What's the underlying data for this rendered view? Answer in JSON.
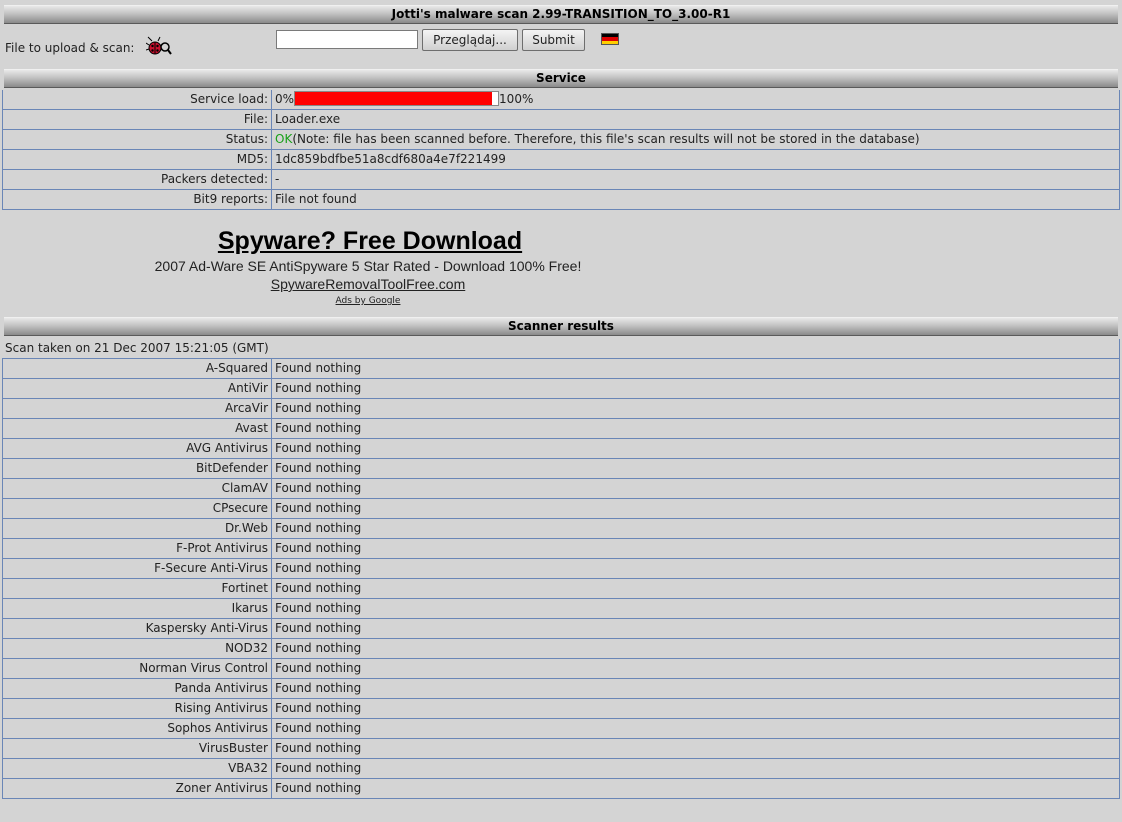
{
  "title": "Jotti's malware scan 2.99-TRANSITION_TO_3.00-R1",
  "upload": {
    "label": "File to upload & scan:",
    "file_value": "",
    "browse_label": "Przeglądaj...",
    "submit_label": "Submit",
    "language_flag": "german-flag-icon"
  },
  "service": {
    "header": "Service",
    "rows": [
      {
        "key": "Service load:",
        "type": "load",
        "min_label": "0%",
        "max_label": "100%",
        "load_fraction": 0.97
      },
      {
        "key": "File:",
        "value": "Loader.exe"
      },
      {
        "key": "Status:",
        "status_ok": "OK",
        "value": "(Note: file has been scanned before. Therefore, this file's scan results will not be stored in the database)"
      },
      {
        "key": "MD5:",
        "value": "1dc859bdfbe51a8cdf680a4e7f221499"
      },
      {
        "key": "Packers detected:",
        "value": "-"
      },
      {
        "key": "Bit9 reports:",
        "value": "File not found"
      }
    ]
  },
  "ad": {
    "title": "Spyware? Free Download",
    "description": "2007 Ad-Ware SE AntiSpyware 5 Star Rated - Download 100% Free!",
    "url": "SpywareRemovalToolFree.com",
    "ads_by": "Ads by Google"
  },
  "scanner": {
    "header": "Scanner results",
    "scan_taken": "Scan taken on 21 Dec 2007 15:21:05 (GMT)",
    "results": [
      {
        "name": "A-Squared",
        "result": "Found nothing"
      },
      {
        "name": "AntiVir",
        "result": "Found nothing"
      },
      {
        "name": "ArcaVir",
        "result": "Found nothing"
      },
      {
        "name": "Avast",
        "result": "Found nothing"
      },
      {
        "name": "AVG Antivirus",
        "result": "Found nothing"
      },
      {
        "name": "BitDefender",
        "result": "Found nothing"
      },
      {
        "name": "ClamAV",
        "result": "Found nothing"
      },
      {
        "name": "CPsecure",
        "result": "Found nothing"
      },
      {
        "name": "Dr.Web",
        "result": "Found nothing"
      },
      {
        "name": "F-Prot Antivirus",
        "result": "Found nothing"
      },
      {
        "name": "F-Secure Anti-Virus",
        "result": "Found nothing"
      },
      {
        "name": "Fortinet",
        "result": "Found nothing"
      },
      {
        "name": "Ikarus",
        "result": "Found nothing"
      },
      {
        "name": "Kaspersky Anti-Virus",
        "result": "Found nothing"
      },
      {
        "name": "NOD32",
        "result": "Found nothing"
      },
      {
        "name": "Norman Virus Control",
        "result": "Found nothing"
      },
      {
        "name": "Panda Antivirus",
        "result": "Found nothing"
      },
      {
        "name": "Rising Antivirus",
        "result": "Found nothing"
      },
      {
        "name": "Sophos Antivirus",
        "result": "Found nothing"
      },
      {
        "name": "VirusBuster",
        "result": "Found nothing"
      },
      {
        "name": "VBA32",
        "result": "Found nothing"
      },
      {
        "name": "Zoner Antivirus",
        "result": "Found nothing"
      }
    ]
  },
  "colors": {
    "load_fill": "#ff0000",
    "ok": "#1aa01a",
    "row_border": "#6a86b6"
  }
}
